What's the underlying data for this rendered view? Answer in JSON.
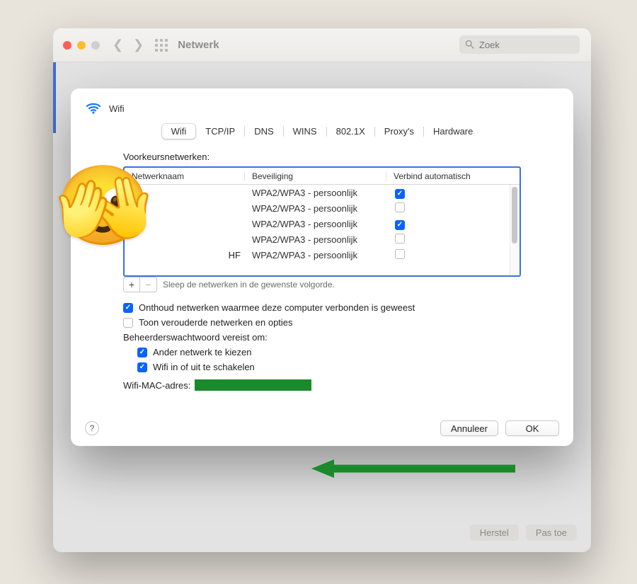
{
  "window": {
    "title": "Netwerk",
    "search_placeholder": "Zoek",
    "bottom_revert": "Herstel",
    "bottom_apply": "Pas toe"
  },
  "sheet": {
    "icon_name": "wifi-icon",
    "title": "Wifi",
    "tabs": [
      "Wifi",
      "TCP/IP",
      "DNS",
      "WINS",
      "802.1X",
      "Proxy's",
      "Hardware"
    ],
    "preferred_label": "Voorkeursnetwerken:",
    "columns": {
      "name": "Netwerknaam",
      "security": "Beveiliging",
      "auto": "Verbind automatisch"
    },
    "networks": [
      {
        "name": "",
        "security": "WPA2/WPA3 - persoonlijk",
        "auto": true
      },
      {
        "name": "",
        "security": "WPA2/WPA3 - persoonlijk",
        "auto": false
      },
      {
        "name": "",
        "security": "WPA2/WPA3 - persoonlijk",
        "auto": true
      },
      {
        "name": "",
        "security": "WPA2/WPA3 - persoonlijk",
        "auto": false
      },
      {
        "name": "HF",
        "security": "WPA2/WPA3 - persoonlijk",
        "auto": false
      }
    ],
    "drag_hint": "Sleep de netwerken in de gewenste volgorde.",
    "remember_label": "Onthoud netwerken waarmee deze computer verbonden is geweest",
    "remember_checked": true,
    "legacy_label": "Toon verouderde netwerken en opties",
    "legacy_checked": false,
    "admin_label": "Beheerderswachtwoord vereist om:",
    "admin_opts": [
      {
        "label": "Ander netwerk te kiezen",
        "checked": true
      },
      {
        "label": "Wifi in of uit te schakelen",
        "checked": true
      }
    ],
    "mac_label": "Wifi-MAC-adres:",
    "footer": {
      "cancel": "Annuleer",
      "ok": "OK",
      "help": "?"
    }
  }
}
